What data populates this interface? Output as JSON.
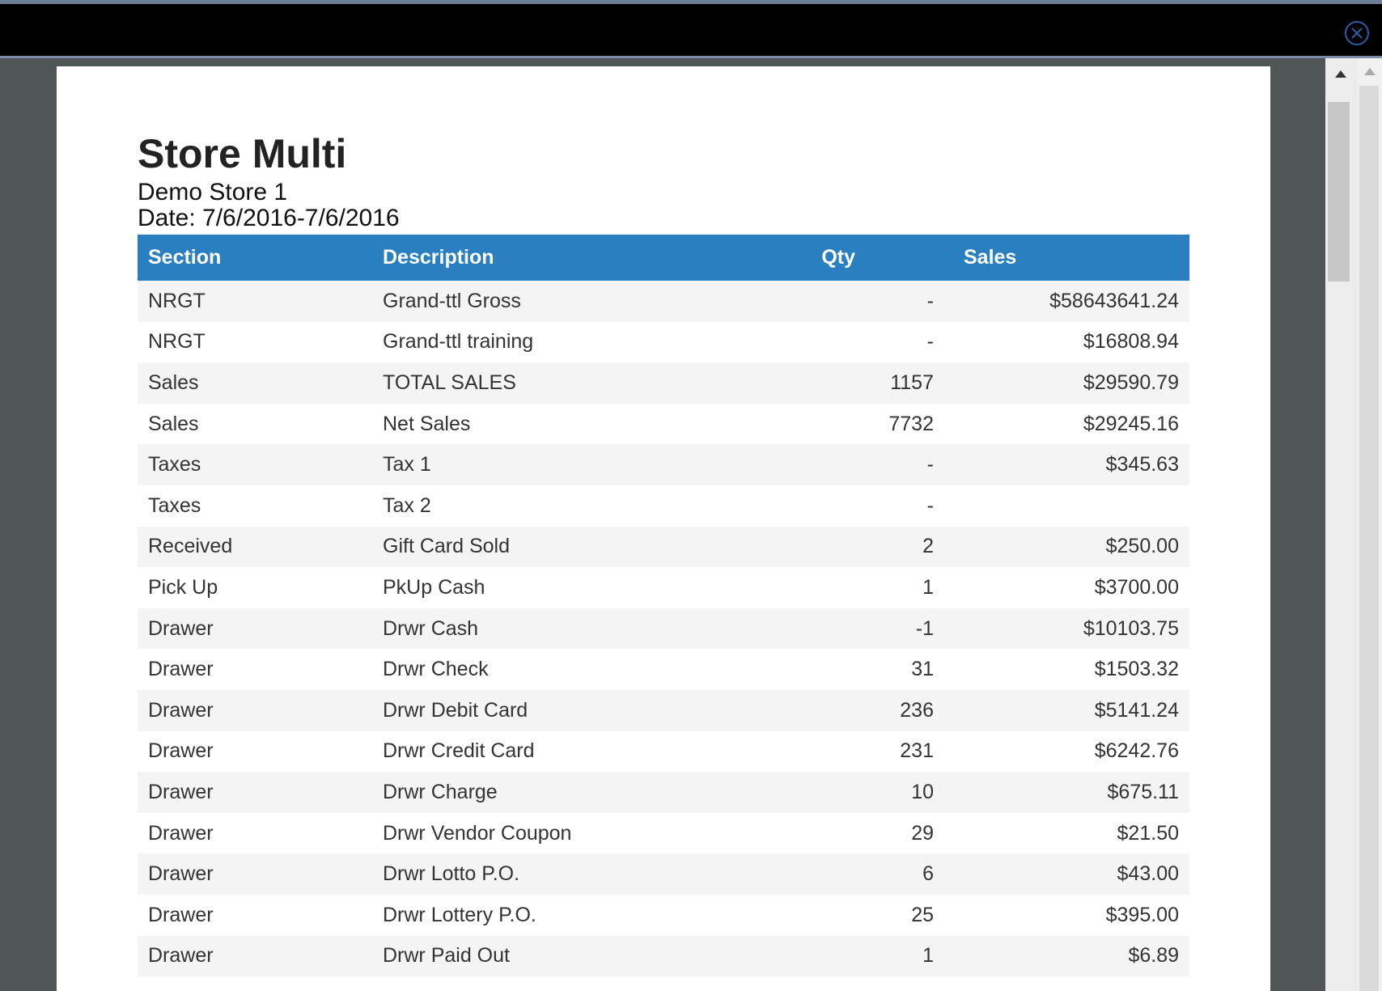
{
  "report": {
    "title": "Store Multi",
    "store": "Demo Store 1",
    "date": "Date: 7/6/2016-7/6/2016"
  },
  "table": {
    "headers": {
      "section": "Section",
      "description": "Description",
      "qty": "Qty",
      "sales": "Sales"
    },
    "rows": [
      {
        "section": "NRGT",
        "description": "Grand-ttl Gross",
        "qty": "-",
        "sales": "$58643641.24"
      },
      {
        "section": "NRGT",
        "description": "Grand-ttl training",
        "qty": "-",
        "sales": "$16808.94"
      },
      {
        "section": "Sales",
        "description": "TOTAL SALES",
        "qty": "1157",
        "sales": "$29590.79"
      },
      {
        "section": "Sales",
        "description": "Net Sales",
        "qty": "7732",
        "sales": "$29245.16"
      },
      {
        "section": "Taxes",
        "description": "Tax 1",
        "qty": "-",
        "sales": "$345.63"
      },
      {
        "section": "Taxes",
        "description": "Tax 2",
        "qty": "-",
        "sales": ""
      },
      {
        "section": "Received",
        "description": "Gift Card Sold",
        "qty": "2",
        "sales": "$250.00"
      },
      {
        "section": "Pick Up",
        "description": "PkUp Cash",
        "qty": "1",
        "sales": "$3700.00"
      },
      {
        "section": "Drawer",
        "description": "Drwr Cash",
        "qty": "-1",
        "sales": "$10103.75"
      },
      {
        "section": "Drawer",
        "description": "Drwr Check",
        "qty": "31",
        "sales": "$1503.32"
      },
      {
        "section": "Drawer",
        "description": "Drwr Debit Card",
        "qty": "236",
        "sales": "$5141.24"
      },
      {
        "section": "Drawer",
        "description": "Drwr Credit Card",
        "qty": "231",
        "sales": "$6242.76"
      },
      {
        "section": "Drawer",
        "description": "Drwr Charge",
        "qty": "10",
        "sales": "$675.11"
      },
      {
        "section": "Drawer",
        "description": "Drwr Vendor Coupon",
        "qty": "29",
        "sales": "$21.50"
      },
      {
        "section": "Drawer",
        "description": "Drwr Lotto P.O.",
        "qty": "6",
        "sales": "$43.00"
      },
      {
        "section": "Drawer",
        "description": "Drwr Lottery P.O.",
        "qty": "25",
        "sales": "$395.00"
      },
      {
        "section": "Drawer",
        "description": "Drwr Paid Out",
        "qty": "1",
        "sales": "$6.89"
      }
    ]
  },
  "colors": {
    "header_bg": "#2a7fc0",
    "close_icon": "#2a5da8"
  },
  "icons": {
    "close": "close-icon"
  }
}
